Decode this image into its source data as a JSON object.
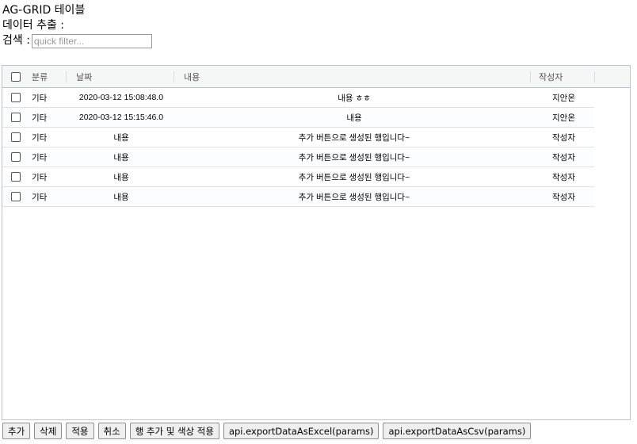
{
  "page": {
    "title": "AG-GRID 테이블",
    "export_label": "데이터 추출 :",
    "search_label": "검색 :",
    "search_placeholder": "quick filter..."
  },
  "grid": {
    "columns": [
      {
        "key": "category",
        "label": "분류"
      },
      {
        "key": "date",
        "label": "날짜"
      },
      {
        "key": "content",
        "label": "내용"
      },
      {
        "key": "author",
        "label": "작성자"
      }
    ],
    "rows": [
      {
        "category": "기타",
        "date": "2020-03-12 15:08:48.0",
        "content": "내용 ㅎㅎ",
        "author": "지안온",
        "checked": false
      },
      {
        "category": "기타",
        "date": "2020-03-12 15:15:46.0",
        "content": "내용",
        "author": "지안온",
        "checked": false
      },
      {
        "category": "기타",
        "date": "내용",
        "content": "추가 버튼으로 생성된 행입니다~",
        "author": "작성자",
        "checked": false
      },
      {
        "category": "기타",
        "date": "내용",
        "content": "추가 버튼으로 생성된 행입니다~",
        "author": "작성자",
        "checked": false
      },
      {
        "category": "기타",
        "date": "내용",
        "content": "추가 버튼으로 생성된 행입니다~",
        "author": "작성자",
        "checked": false
      },
      {
        "category": "기타",
        "date": "내용",
        "content": "추가 버튼으로 생성된 행입니다~",
        "author": "작성자",
        "checked": false
      }
    ]
  },
  "buttons": {
    "add": "추가",
    "delete": "삭제",
    "apply": "적용",
    "cancel": "취소",
    "add_row_color": "행 추가 및 색상 적용",
    "export_excel": "api.exportDataAsExcel(params)",
    "export_csv": "api.exportDataAsCsv(params)"
  },
  "colors": {
    "grid_border": "#bdc3c7",
    "header_bg": "#f5f7f7",
    "row_border": "#dde2eb"
  }
}
